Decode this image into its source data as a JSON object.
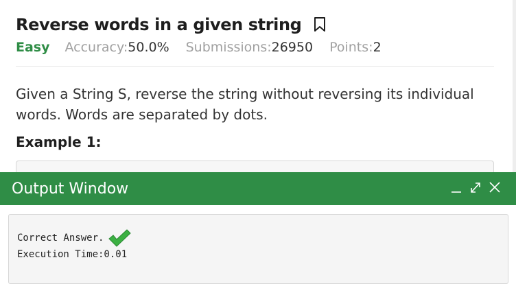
{
  "problem": {
    "title": "Reverse words in a given string",
    "difficulty": "Easy",
    "accuracy_label": "Accuracy:",
    "accuracy_value": "50.0%",
    "submissions_label": "Submissions:",
    "submissions_value": "26950",
    "points_label": "Points:",
    "points_value": "2",
    "description": "Given a String S, reverse the string without reversing its individual words. Words are separated by dots.",
    "example_heading": "Example 1:"
  },
  "output_window": {
    "title": "Output Window",
    "result_text": "Correct Answer.",
    "execution_time": "Execution Time:0.01"
  },
  "colors": {
    "accent": "#2f8d46",
    "check": "#3cb043"
  },
  "icons": [
    "bookmark-icon",
    "minimize-icon",
    "expand-icon",
    "close-icon",
    "checkmark-icon"
  ]
}
